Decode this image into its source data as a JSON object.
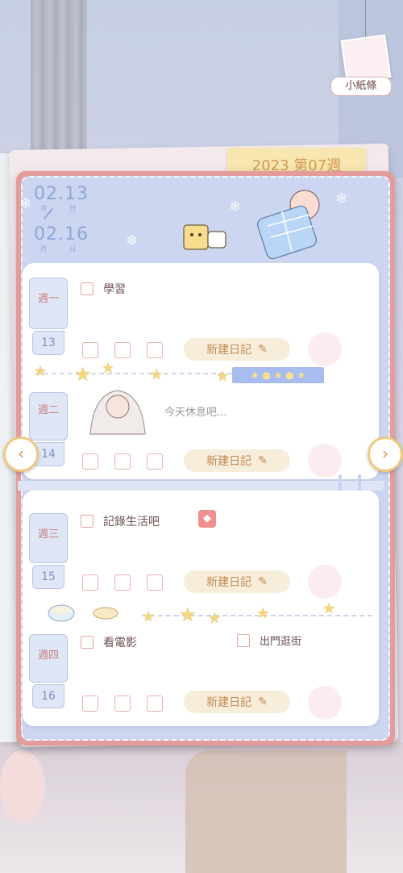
{
  "header": {
    "week_label": "2023 第07週",
    "date_start": "02.13",
    "date_end": "02.16",
    "month_label": "月",
    "day_label": "日"
  },
  "note_button": {
    "label": "小紙條",
    "icon": "note-portrait-icon"
  },
  "days": [
    {
      "weekday": "週一",
      "date": "13",
      "tasks": [
        "學習"
      ],
      "new_entry_label": "新建日記"
    },
    {
      "weekday": "週二",
      "date": "14",
      "tasks": [],
      "rest_text": "今天休息吧...",
      "new_entry_label": "新建日記"
    },
    {
      "weekday": "週三",
      "date": "15",
      "tasks": [
        "記錄生活吧"
      ],
      "new_entry_label": "新建日記"
    },
    {
      "weekday": "週四",
      "date": "16",
      "tasks": [
        "看電影",
        "出門逛街"
      ],
      "new_entry_label": "新建日記"
    }
  ],
  "nav": {
    "prev_icon": "chevron-left-icon",
    "next_icon": "chevron-right-icon"
  },
  "colors": {
    "notebook_border": "#e49c9a",
    "tab_bg": "#f7e6b0",
    "tab_text": "#d39a52",
    "button_bg": "#f6edda",
    "button_text": "#c58a55",
    "page_bg": "#ccd6f0"
  }
}
